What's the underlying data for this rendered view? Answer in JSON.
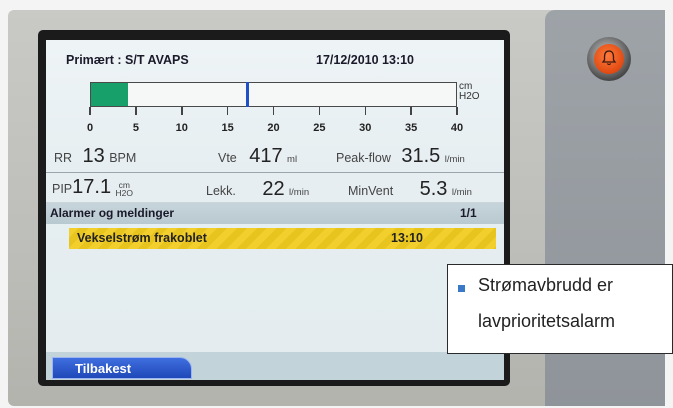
{
  "device": {
    "alarm_button_icon": "alarm-silence-bell-icon",
    "accent_colors": {
      "alarm_button": "#e04a12",
      "bar_fill": "#18a06a",
      "alarm_banner": "#f2cf2c",
      "back_button": "#2a55c8"
    }
  },
  "screen": {
    "mode": "Primært : S/T AVAPS",
    "datetime": "17/12/2010 13:10",
    "pressure_bar": {
      "unit_top": "cm",
      "unit_bottom": "H2O",
      "scale": [
        "0",
        "5",
        "10",
        "15",
        "20",
        "25",
        "30",
        "35",
        "40"
      ],
      "fill_value": 4,
      "marker_value": 17,
      "max": 40
    },
    "row1": {
      "rr_label": "RR",
      "rr_value": "13",
      "rr_unit": "BPM",
      "vte_label": "Vte",
      "vte_value": "417",
      "vte_unit": "ml",
      "peak_label": "Peak-flow",
      "peak_value": "31.5",
      "peak_unit": "l/min"
    },
    "row2": {
      "pip_label": "PIP",
      "pip_value": "17.1",
      "pip_unit_top": "cm",
      "pip_unit_bottom": "H2O",
      "lekk_label": "Lekk.",
      "lekk_value": "22",
      "lekk_unit": "l/min",
      "minvent_label": "MinVent",
      "minvent_value": "5.3",
      "minvent_unit": "l/min"
    },
    "alarms": {
      "title": "Alarmer og meldinger",
      "page": "1/1",
      "items": [
        {
          "text": "Vekselstrøm frakoblet",
          "time": "13:10"
        }
      ]
    },
    "back_button": "Tilbakest"
  },
  "callout": {
    "line1": "Strømavbrudd er",
    "line2": "lavprioritetsalarm"
  }
}
